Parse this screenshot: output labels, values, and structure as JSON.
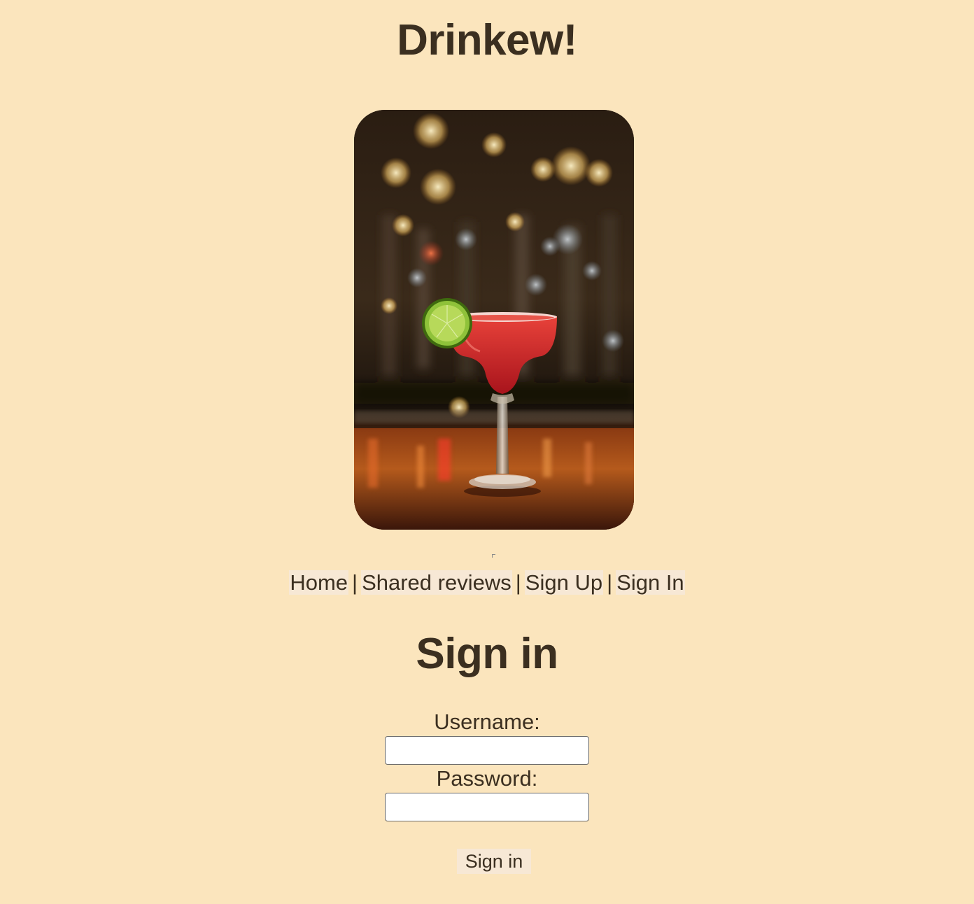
{
  "header": {
    "site_title": "Drinkew!"
  },
  "nav": {
    "items": [
      {
        "label": "Home"
      },
      {
        "label": "Shared reviews"
      },
      {
        "label": "Sign Up"
      },
      {
        "label": "Sign In"
      }
    ],
    "separator": "|"
  },
  "main": {
    "heading": "Sign in",
    "form": {
      "username_label": "Username:",
      "username_value": "",
      "password_label": "Password:",
      "password_value": "",
      "submit_label": "Sign in"
    }
  },
  "colors": {
    "background": "#fbe5bd",
    "text": "#3b2f20",
    "link_background": "#f7e8d5"
  }
}
